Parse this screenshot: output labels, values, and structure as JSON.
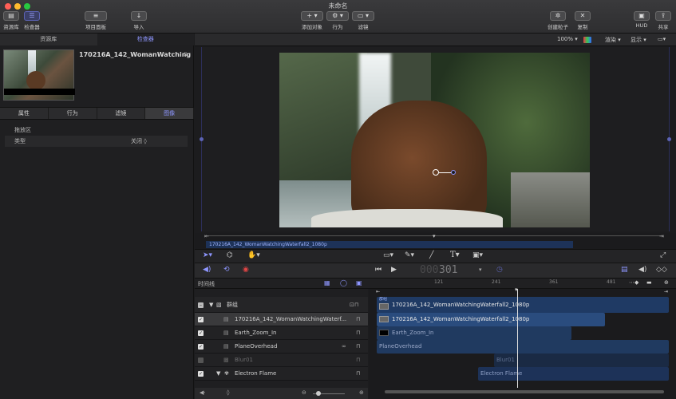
{
  "window": {
    "title": "未命名"
  },
  "toolbar": {
    "library": "资源库",
    "inspector": "检查器",
    "project_pane": "项目面板",
    "import": "导入",
    "add_object": "添加对象",
    "behaviors": "行为",
    "filters": "滤镜",
    "make_particles": "创建粒子",
    "replicate": "复制",
    "hud": "HUD",
    "share": "共享"
  },
  "left_panel": {
    "tab_library": "资源库",
    "tab_inspector": "检查器",
    "clip_title": "170216A_142_WomanWatching",
    "tabs": [
      "属性",
      "行为",
      "滤镜",
      "图像"
    ],
    "section": "拖放区",
    "prop_label": "类型",
    "prop_value": "关闭 ◊"
  },
  "canvas_bar": {
    "zoom": "100% ▾",
    "render": "渲染 ▾",
    "view": "显示 ▾"
  },
  "scrubber": {
    "clip_label": "170216A_142_WomanWatchingWaterfall2_1080p"
  },
  "transport": {
    "timecode_ghost": "000",
    "timecode": "301"
  },
  "timeline": {
    "label": "时间线",
    "ticks": [
      "121",
      "241",
      "361",
      "481"
    ],
    "group_name": "群组",
    "layers": [
      {
        "name": "170216A_142_WomanWatchingWaterf...",
        "checked": true,
        "selected": true
      },
      {
        "name": "Earth_Zoom_In",
        "checked": true
      },
      {
        "name": "PlaneOverhead",
        "checked": true
      },
      {
        "name": "Blur01",
        "checked": false
      },
      {
        "name": "Electron Flame",
        "checked": true
      }
    ],
    "clips": {
      "group_badge": "群组",
      "c1": "170216A_142_WomanWatchingWaterfall2_1080p",
      "c2": "170216A_142_WomanWatchingWaterfall2_1080p",
      "c3": "Earth_Zoom_In",
      "c4": "PlaneOverhead",
      "c5": "Blur01",
      "c6": "Electron Flame"
    }
  },
  "colors": {
    "accent": "#8e96ff",
    "clip": "#2a4c7e",
    "record": "#e04545"
  }
}
